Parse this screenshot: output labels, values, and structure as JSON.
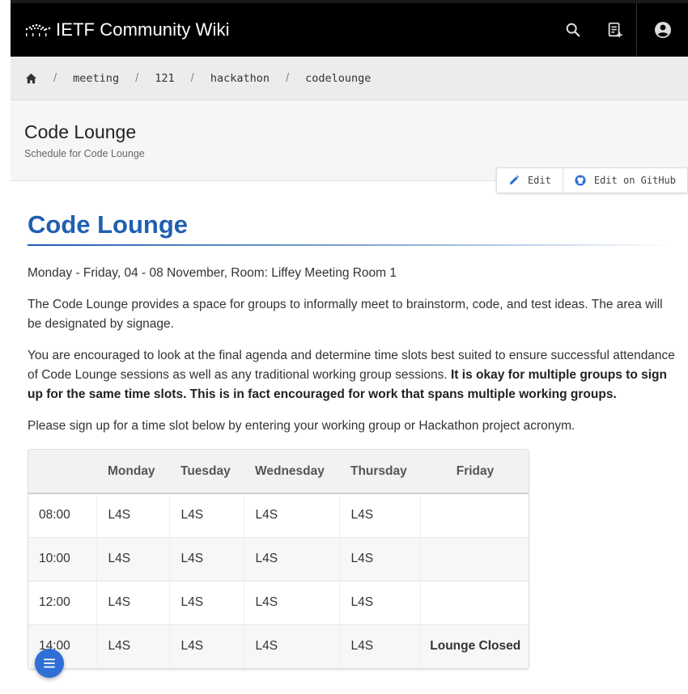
{
  "header": {
    "site_title": "IETF Community Wiki",
    "icons": [
      "search-icon",
      "new-page-icon",
      "account-icon"
    ]
  },
  "breadcrumb": {
    "items": [
      "meeting",
      "121",
      "hackathon",
      "codelounge"
    ]
  },
  "page": {
    "title": "Code Lounge",
    "subtitle": "Schedule for Code Lounge"
  },
  "actions": {
    "edit": "Edit",
    "edit_github": "Edit on GitHub"
  },
  "content": {
    "heading": "Code Lounge",
    "p1": "Monday - Friday, 04 - 08 November, Room: Liffey Meeting Room 1",
    "p2": "The Code Lounge provides a space for groups to informally meet to brainstorm, code, and test ideas. The area will be designated by signage.",
    "p3_normal": "You are encouraged to look at the final agenda and determine time slots best suited to ensure successful attendance of Code Lounge sessions as well as any traditional working group sessions. ",
    "p3_bold": "It is okay for multiple groups to sign up for the same time slots. This is in fact encouraged for work that spans multiple working groups.",
    "p4": "Please sign up for a time slot below by entering your working group or Hackathon project acronym."
  },
  "schedule": {
    "headers": [
      "",
      "Monday",
      "Tuesday",
      "Wednesday",
      "Thursday",
      "Friday"
    ],
    "rows": [
      {
        "time": "08:00",
        "cells": [
          "L4S",
          "L4S",
          "L4S",
          "L4S",
          ""
        ]
      },
      {
        "time": "10:00",
        "cells": [
          "L4S",
          "L4S",
          "L4S",
          "L4S",
          ""
        ]
      },
      {
        "time": "12:00",
        "cells": [
          "L4S",
          "L4S",
          "L4S",
          "L4S",
          ""
        ]
      },
      {
        "time": "14:00",
        "cells": [
          "L4S",
          "L4S",
          "L4S",
          "L4S",
          "Lounge Closed"
        ]
      }
    ]
  },
  "colors": {
    "accent": "#1f5fb0",
    "fab": "#2f6fd6",
    "topbar": "#000000"
  }
}
